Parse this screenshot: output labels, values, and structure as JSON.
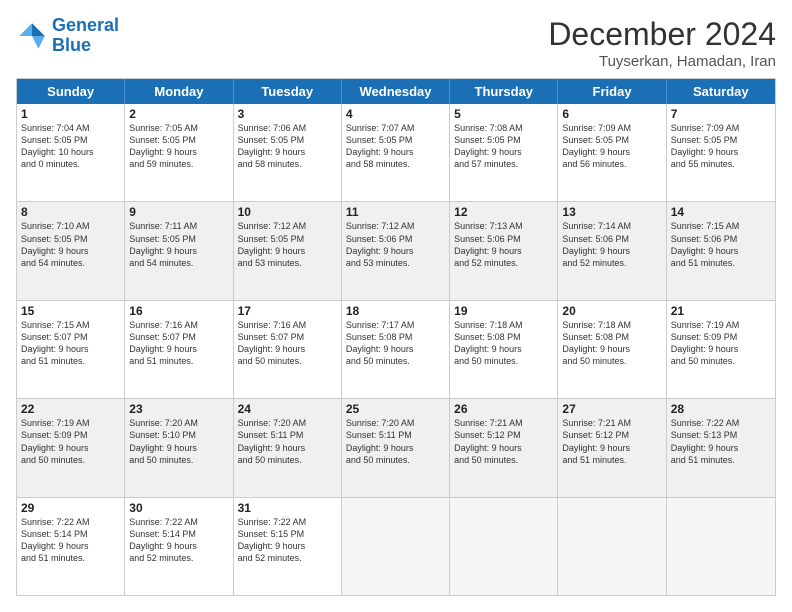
{
  "logo": {
    "line1": "General",
    "line2": "Blue"
  },
  "title": "December 2024",
  "subtitle": "Tuyserkan, Hamadan, Iran",
  "header_days": [
    "Sunday",
    "Monday",
    "Tuesday",
    "Wednesday",
    "Thursday",
    "Friday",
    "Saturday"
  ],
  "weeks": [
    [
      {
        "day": "1",
        "info": "Sunrise: 7:04 AM\nSunset: 5:05 PM\nDaylight: 10 hours\nand 0 minutes.",
        "shade": false
      },
      {
        "day": "2",
        "info": "Sunrise: 7:05 AM\nSunset: 5:05 PM\nDaylight: 9 hours\nand 59 minutes.",
        "shade": false
      },
      {
        "day": "3",
        "info": "Sunrise: 7:06 AM\nSunset: 5:05 PM\nDaylight: 9 hours\nand 58 minutes.",
        "shade": false
      },
      {
        "day": "4",
        "info": "Sunrise: 7:07 AM\nSunset: 5:05 PM\nDaylight: 9 hours\nand 58 minutes.",
        "shade": false
      },
      {
        "day": "5",
        "info": "Sunrise: 7:08 AM\nSunset: 5:05 PM\nDaylight: 9 hours\nand 57 minutes.",
        "shade": false
      },
      {
        "day": "6",
        "info": "Sunrise: 7:09 AM\nSunset: 5:05 PM\nDaylight: 9 hours\nand 56 minutes.",
        "shade": false
      },
      {
        "day": "7",
        "info": "Sunrise: 7:09 AM\nSunset: 5:05 PM\nDaylight: 9 hours\nand 55 minutes.",
        "shade": false
      }
    ],
    [
      {
        "day": "8",
        "info": "Sunrise: 7:10 AM\nSunset: 5:05 PM\nDaylight: 9 hours\nand 54 minutes.",
        "shade": true
      },
      {
        "day": "9",
        "info": "Sunrise: 7:11 AM\nSunset: 5:05 PM\nDaylight: 9 hours\nand 54 minutes.",
        "shade": true
      },
      {
        "day": "10",
        "info": "Sunrise: 7:12 AM\nSunset: 5:05 PM\nDaylight: 9 hours\nand 53 minutes.",
        "shade": true
      },
      {
        "day": "11",
        "info": "Sunrise: 7:12 AM\nSunset: 5:06 PM\nDaylight: 9 hours\nand 53 minutes.",
        "shade": true
      },
      {
        "day": "12",
        "info": "Sunrise: 7:13 AM\nSunset: 5:06 PM\nDaylight: 9 hours\nand 52 minutes.",
        "shade": true
      },
      {
        "day": "13",
        "info": "Sunrise: 7:14 AM\nSunset: 5:06 PM\nDaylight: 9 hours\nand 52 minutes.",
        "shade": true
      },
      {
        "day": "14",
        "info": "Sunrise: 7:15 AM\nSunset: 5:06 PM\nDaylight: 9 hours\nand 51 minutes.",
        "shade": true
      }
    ],
    [
      {
        "day": "15",
        "info": "Sunrise: 7:15 AM\nSunset: 5:07 PM\nDaylight: 9 hours\nand 51 minutes.",
        "shade": false
      },
      {
        "day": "16",
        "info": "Sunrise: 7:16 AM\nSunset: 5:07 PM\nDaylight: 9 hours\nand 51 minutes.",
        "shade": false
      },
      {
        "day": "17",
        "info": "Sunrise: 7:16 AM\nSunset: 5:07 PM\nDaylight: 9 hours\nand 50 minutes.",
        "shade": false
      },
      {
        "day": "18",
        "info": "Sunrise: 7:17 AM\nSunset: 5:08 PM\nDaylight: 9 hours\nand 50 minutes.",
        "shade": false
      },
      {
        "day": "19",
        "info": "Sunrise: 7:18 AM\nSunset: 5:08 PM\nDaylight: 9 hours\nand 50 minutes.",
        "shade": false
      },
      {
        "day": "20",
        "info": "Sunrise: 7:18 AM\nSunset: 5:08 PM\nDaylight: 9 hours\nand 50 minutes.",
        "shade": false
      },
      {
        "day": "21",
        "info": "Sunrise: 7:19 AM\nSunset: 5:09 PM\nDaylight: 9 hours\nand 50 minutes.",
        "shade": false
      }
    ],
    [
      {
        "day": "22",
        "info": "Sunrise: 7:19 AM\nSunset: 5:09 PM\nDaylight: 9 hours\nand 50 minutes.",
        "shade": true
      },
      {
        "day": "23",
        "info": "Sunrise: 7:20 AM\nSunset: 5:10 PM\nDaylight: 9 hours\nand 50 minutes.",
        "shade": true
      },
      {
        "day": "24",
        "info": "Sunrise: 7:20 AM\nSunset: 5:11 PM\nDaylight: 9 hours\nand 50 minutes.",
        "shade": true
      },
      {
        "day": "25",
        "info": "Sunrise: 7:20 AM\nSunset: 5:11 PM\nDaylight: 9 hours\nand 50 minutes.",
        "shade": true
      },
      {
        "day": "26",
        "info": "Sunrise: 7:21 AM\nSunset: 5:12 PM\nDaylight: 9 hours\nand 50 minutes.",
        "shade": true
      },
      {
        "day": "27",
        "info": "Sunrise: 7:21 AM\nSunset: 5:12 PM\nDaylight: 9 hours\nand 51 minutes.",
        "shade": true
      },
      {
        "day": "28",
        "info": "Sunrise: 7:22 AM\nSunset: 5:13 PM\nDaylight: 9 hours\nand 51 minutes.",
        "shade": true
      }
    ],
    [
      {
        "day": "29",
        "info": "Sunrise: 7:22 AM\nSunset: 5:14 PM\nDaylight: 9 hours\nand 51 minutes.",
        "shade": false
      },
      {
        "day": "30",
        "info": "Sunrise: 7:22 AM\nSunset: 5:14 PM\nDaylight: 9 hours\nand 52 minutes.",
        "shade": false
      },
      {
        "day": "31",
        "info": "Sunrise: 7:22 AM\nSunset: 5:15 PM\nDaylight: 9 hours\nand 52 minutes.",
        "shade": false
      },
      {
        "day": "",
        "info": "",
        "shade": false,
        "empty": true
      },
      {
        "day": "",
        "info": "",
        "shade": false,
        "empty": true
      },
      {
        "day": "",
        "info": "",
        "shade": false,
        "empty": true
      },
      {
        "day": "",
        "info": "",
        "shade": false,
        "empty": true
      }
    ]
  ]
}
